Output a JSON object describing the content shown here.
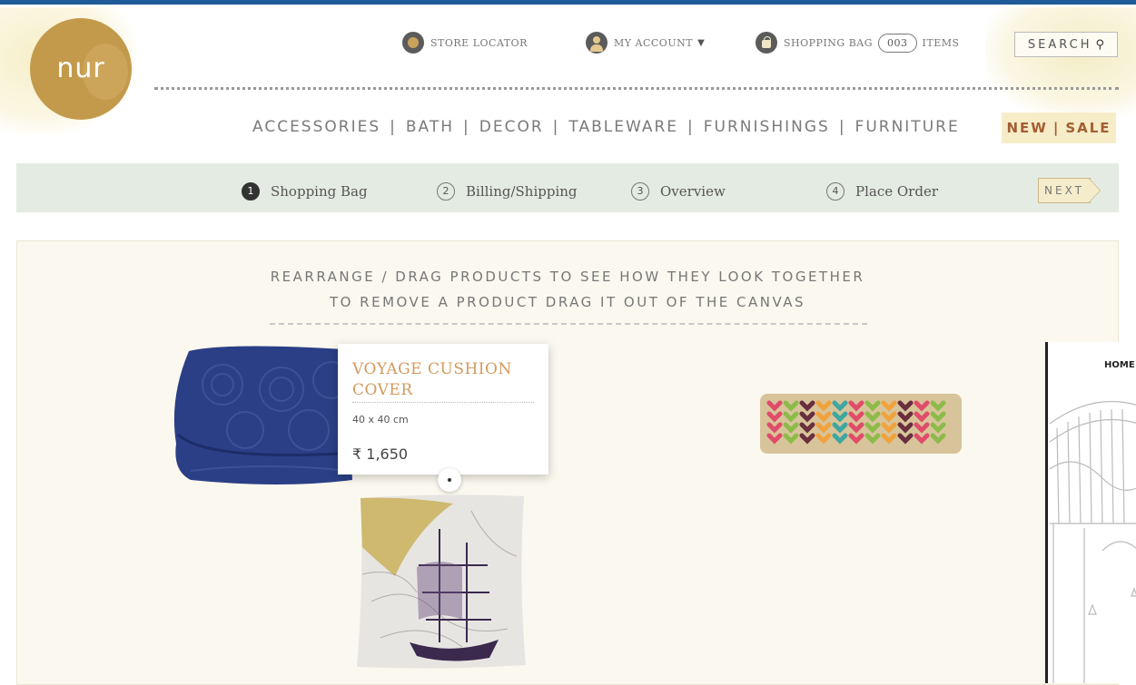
{
  "brand": {
    "logo_text": "nur",
    "accent": "#c39a4b"
  },
  "header": {
    "store_locator": "STORE LOCATOR",
    "my_account": "MY ACCOUNT",
    "shopping_bag": "SHOPPING BAG",
    "bag_count": "003",
    "items_label": "ITEMS",
    "search_label": "SEARCH"
  },
  "nav": {
    "items": [
      "ACCESSORIES",
      "BATH",
      "DECOR",
      "TABLEWARE",
      "FURNISHINGS",
      "FURNITURE"
    ],
    "separator": "|",
    "promo": {
      "new": "NEW",
      "sale": "SALE"
    }
  },
  "checkout": {
    "steps": [
      {
        "number": "1",
        "label": "Shopping Bag",
        "active": true
      },
      {
        "number": "2",
        "label": "Billing/Shipping",
        "active": false
      },
      {
        "number": "3",
        "label": "Overview",
        "active": false
      },
      {
        "number": "4",
        "label": "Place Order",
        "active": false
      }
    ],
    "next_label": "NEXT"
  },
  "canvas": {
    "instruction_1": "REARRANGE / DRAG PRODUCTS TO SEE HOW THEY LOOK TOGETHER",
    "instruction_2": "TO REMOVE A PRODUCT DRAG IT OUT OF THE CANVAS",
    "popup": {
      "name": "VOYAGE CUSHION COVER",
      "size": "40 x 40 cm",
      "price": "₹ 1,650"
    }
  },
  "side_panel": {
    "home_label": "HOME"
  },
  "colors": {
    "step_bar": "#e4ebe2",
    "canvas_bg": "#fbf8ef",
    "promo_text": "#a45d31",
    "product_title": "#d39a5c"
  }
}
